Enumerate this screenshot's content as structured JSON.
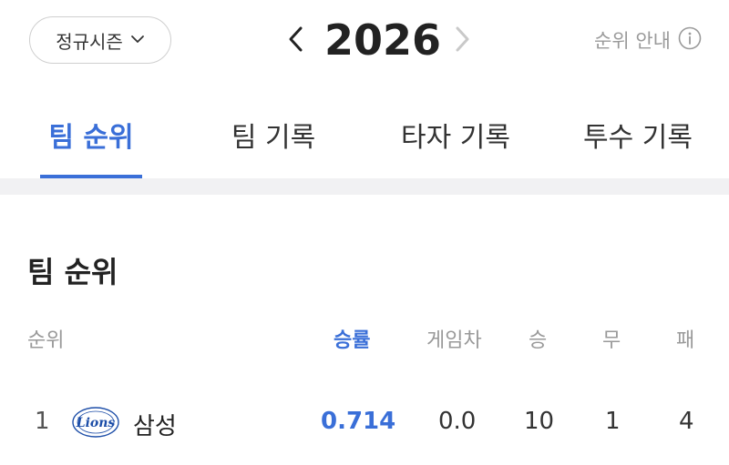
{
  "header": {
    "season_select": "정규시즌",
    "year": "2026",
    "rank_guide": "순위 안내"
  },
  "tabs": [
    {
      "label": "팀 순위",
      "active": true
    },
    {
      "label": "팀 기록",
      "active": false
    },
    {
      "label": "타자 기록",
      "active": false
    },
    {
      "label": "투수 기록",
      "active": false
    }
  ],
  "section": {
    "title": "팀 순위"
  },
  "table": {
    "columns": [
      "순위",
      "승률",
      "게임차",
      "승",
      "무",
      "패"
    ],
    "rows": [
      {
        "rank": "1",
        "logo_text": "Lions",
        "team": "삼성",
        "wpct": "0.714",
        "gb": "0.0",
        "w": "10",
        "d": "1",
        "l": "4"
      }
    ]
  },
  "colors": {
    "accent": "#3a6fd8",
    "muted": "#999999",
    "band": "#f1f1f3",
    "logo_blue": "#1d4ea8"
  }
}
